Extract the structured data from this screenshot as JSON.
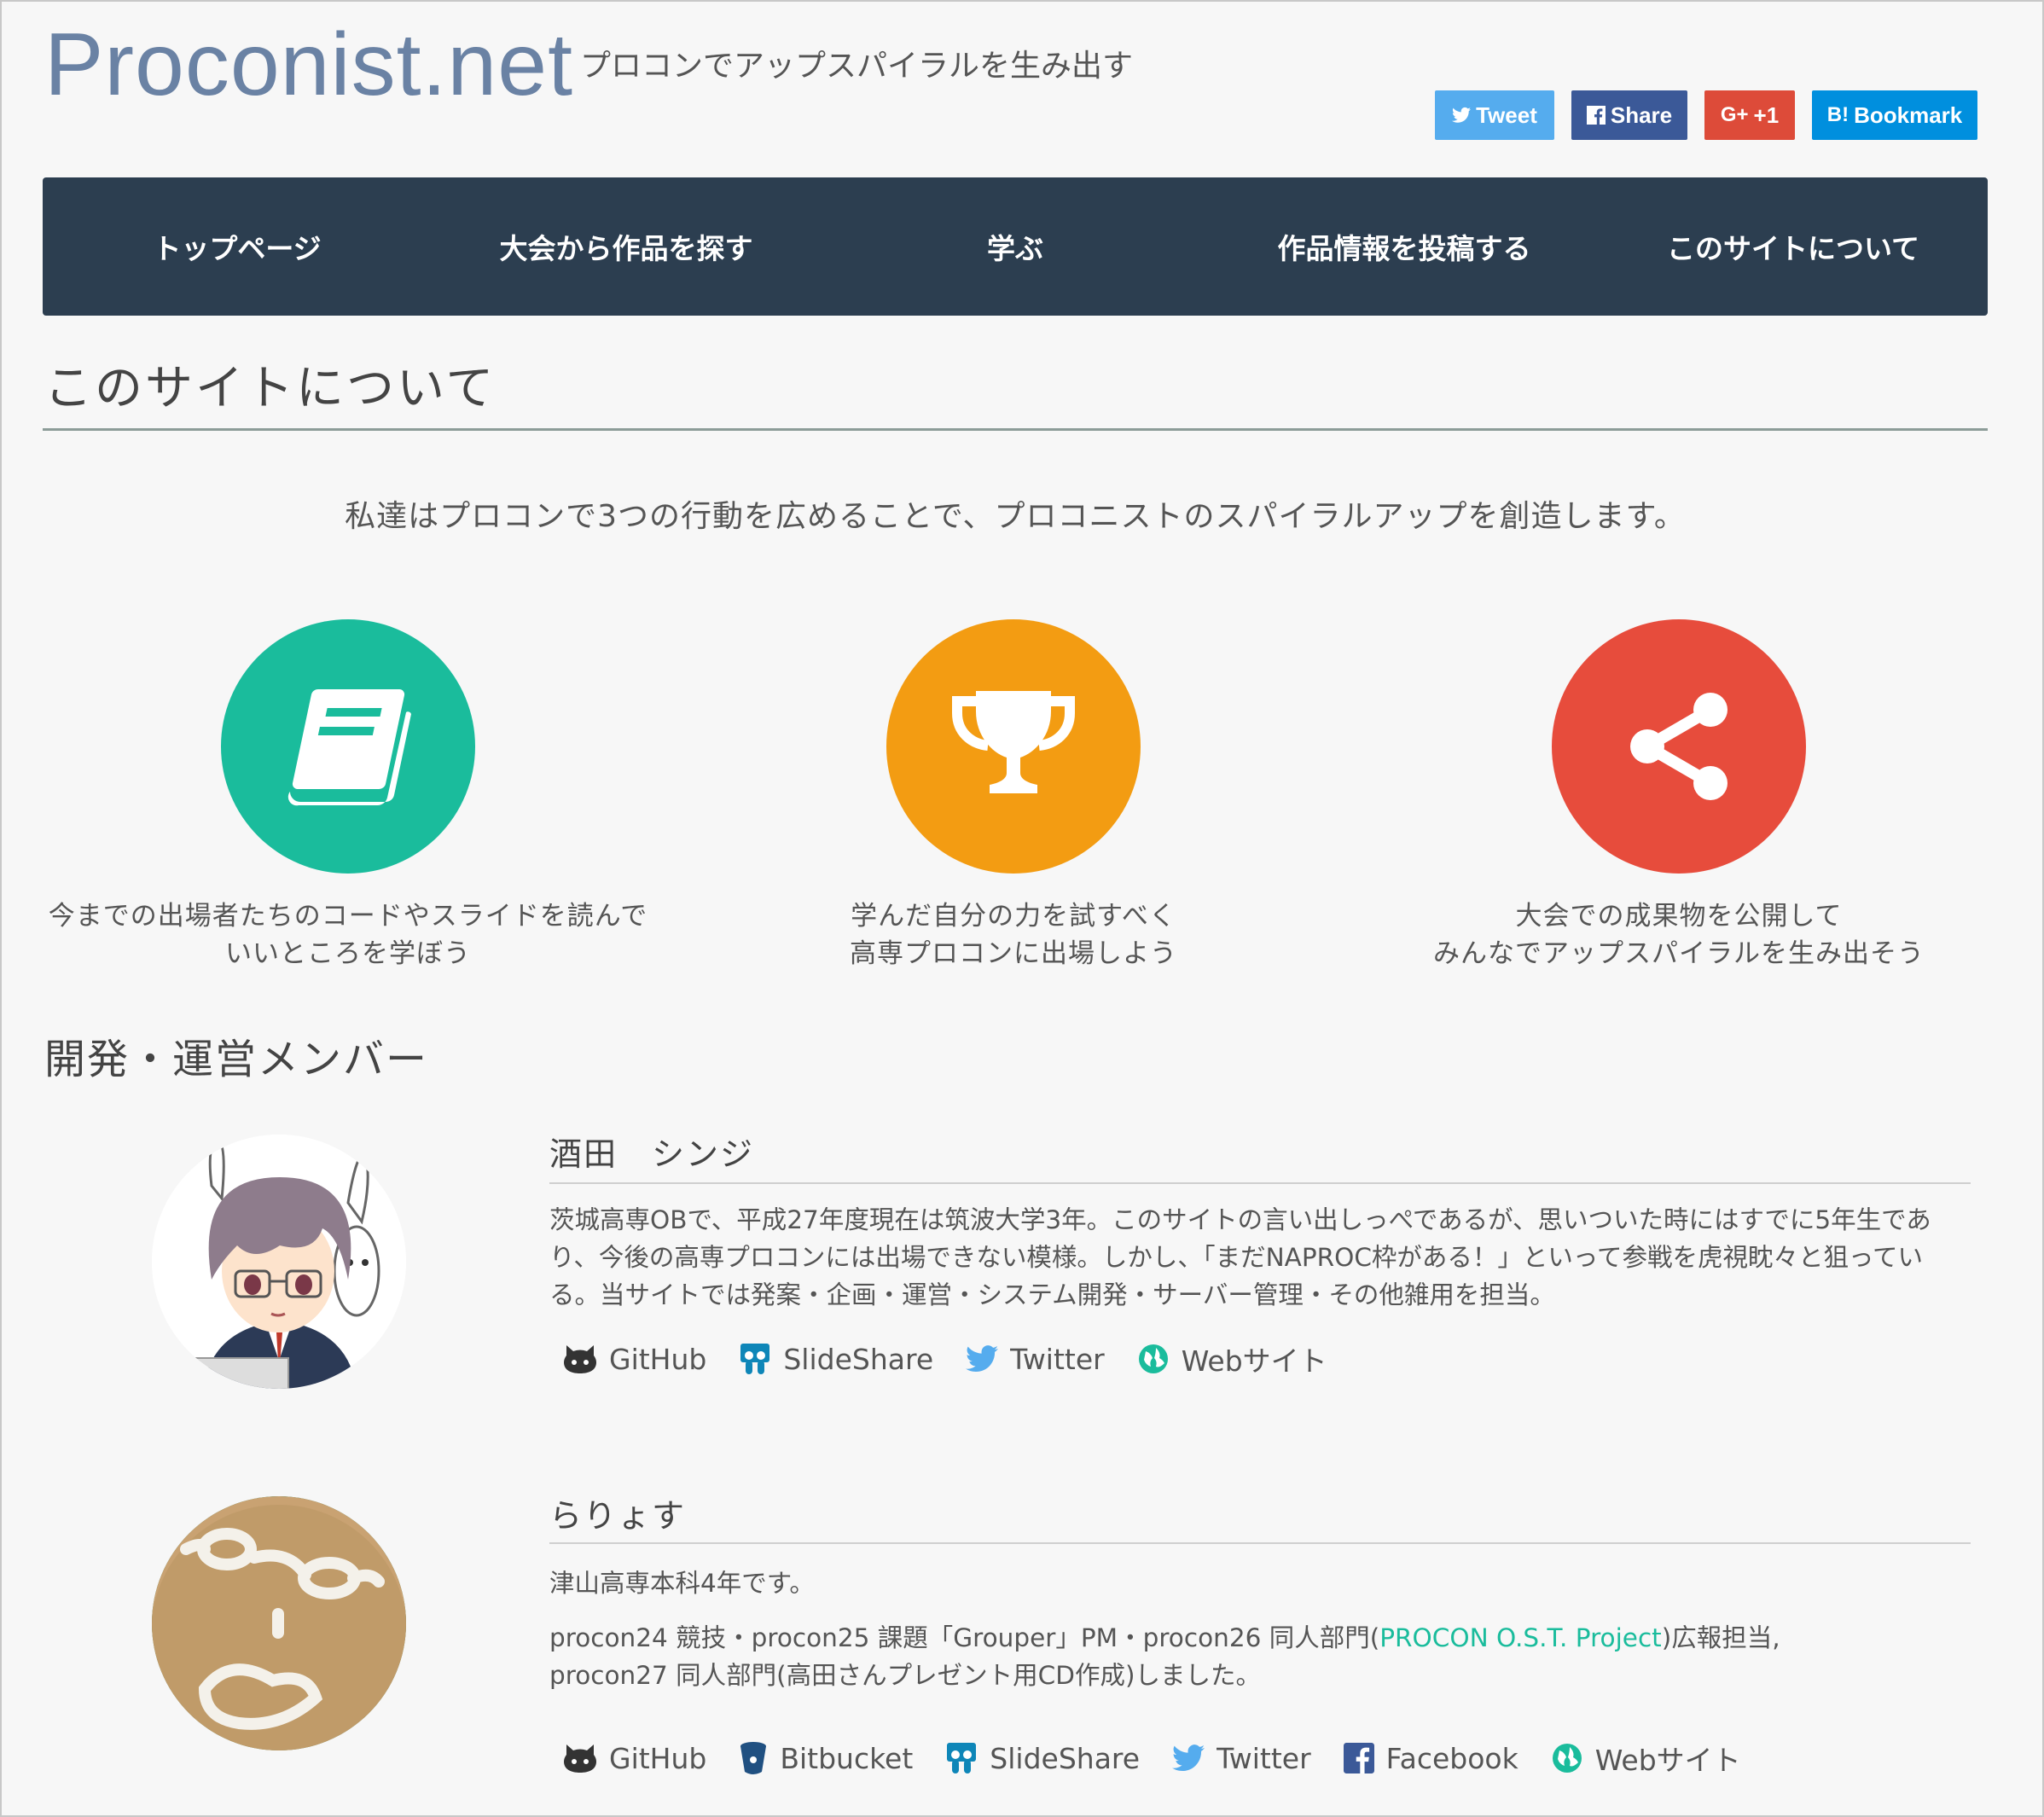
{
  "site": {
    "title": "Proconist.net",
    "tagline": "プロコンでアップスパイラルを生み出す"
  },
  "share_buttons": [
    {
      "label": "Tweet",
      "icon": "twitter-bird-icon",
      "color": "#55acee"
    },
    {
      "label": "Share",
      "icon": "facebook-icon",
      "color": "#3b5998"
    },
    {
      "label": "+1",
      "icon_text": "G+",
      "icon": "google-plus-icon",
      "color": "#dd4b39"
    },
    {
      "label": "Bookmark",
      "icon_text": "B!",
      "icon": "hatena-bookmark-icon",
      "color": "#008fde"
    }
  ],
  "nav": {
    "items": [
      {
        "label": "トップページ"
      },
      {
        "label": "大会から作品を探す"
      },
      {
        "label": "学ぶ"
      },
      {
        "label": "作品情報を投稿する"
      },
      {
        "label": "このサイトについて"
      }
    ]
  },
  "page": {
    "heading": "このサイトについて",
    "lead": "私達はプロコンで3つの行動を広めることで、プロコニストのスパイラルアップを創造します。"
  },
  "features": [
    {
      "icon": "book-icon",
      "color": "#1abc9c",
      "line1": "今までの出場者たちのコードやスライドを読んで",
      "line2": "いいところを学ぼう"
    },
    {
      "icon": "trophy-icon",
      "color": "#f39c12",
      "line1": "学んだ自分の力を試すべく",
      "line2": "高専プロコンに出場しよう"
    },
    {
      "icon": "share-icon",
      "color": "#e74c3c",
      "line1": "大会での成果物を公開して",
      "line2": "みんなでアップスパイラルを生み出そう"
    }
  ],
  "members_heading": "開発・運営メンバー",
  "members": [
    {
      "name": "酒田　シンジ",
      "avatar": "anime-character-avatar",
      "bio": "茨城高専OBで、平成27年度現在は筑波大学3年。このサイトの言い出しっぺであるが、思いついた時にはすでに5年生であり、今後の高専プロコンには出場できない模様。しかし、「まだNAPROC枠がある！」といって参戦を虎視眈々と狙っている。当サイトでは発案・企画・運営・システム開発・サーバー管理・その他雑用を担当。",
      "links": [
        {
          "label": "GitHub",
          "icon": "github-icon"
        },
        {
          "label": "SlideShare",
          "icon": "slideshare-icon"
        },
        {
          "label": "Twitter",
          "icon": "twitter-icon"
        },
        {
          "label": "Webサイト",
          "icon": "globe-icon"
        }
      ]
    },
    {
      "name": "らりょす",
      "avatar": "cookie-face-avatar",
      "bio1": "津山高専本科4年です。",
      "bio2_before": "procon24 競技・procon25 課題「Grouper」PM・procon26 同人部門(",
      "bio2_link": "PROCON O.S.T. Project",
      "bio2_after": ")広報担当,",
      "bio2_line2": "procon27 同人部門(高田さんプレゼント用CD作成)しました。",
      "links": [
        {
          "label": "GitHub",
          "icon": "github-icon"
        },
        {
          "label": "Bitbucket",
          "icon": "bitbucket-icon"
        },
        {
          "label": "SlideShare",
          "icon": "slideshare-icon"
        },
        {
          "label": "Twitter",
          "icon": "twitter-icon"
        },
        {
          "label": "Facebook",
          "icon": "facebook-icon"
        },
        {
          "label": "Webサイト",
          "icon": "globe-icon"
        }
      ]
    }
  ]
}
